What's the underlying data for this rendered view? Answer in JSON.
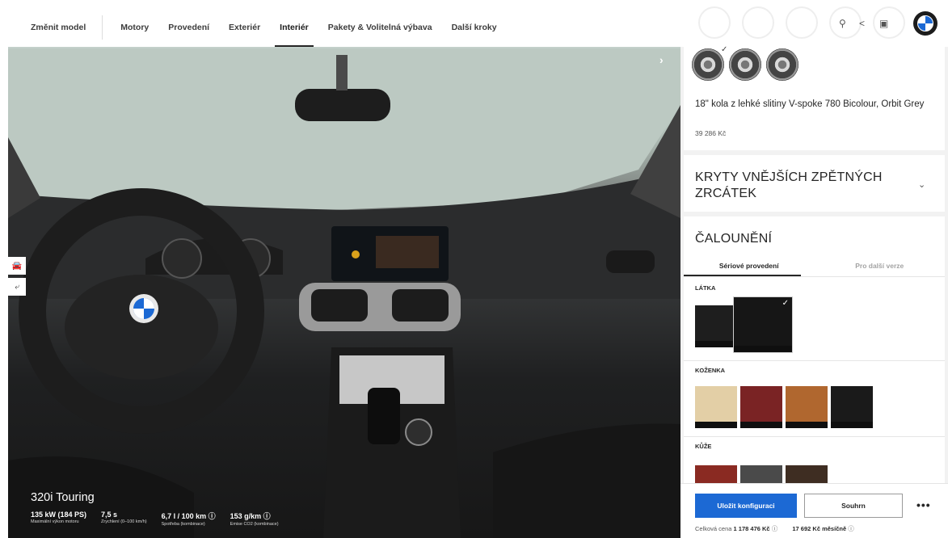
{
  "nav": {
    "items": [
      {
        "label": "Změnit model"
      },
      {
        "label": "Motory"
      },
      {
        "label": "Provedení"
      },
      {
        "label": "Exteriér"
      },
      {
        "label": "Interiér",
        "active": true
      },
      {
        "label": "Pakety & Volitelná výbava"
      },
      {
        "label": "Další kroky"
      }
    ]
  },
  "toolbar": {
    "icons": [
      "location-pin-icon",
      "share-icon",
      "save-disk-icon",
      "bmw-logo"
    ]
  },
  "wheels": {
    "name": "18\" kola z lehké slitiny V-spoke 780 Bicolour, Orbit Grey",
    "price": "39 286 Kč"
  },
  "mirror_section": {
    "title": "KRYTY VNĚJŠÍCH ZPĚTNÝCH ZRCÁTEK"
  },
  "upholstery": {
    "title": "ČALOUNĚNÍ",
    "tabs": [
      "Sériové provedení",
      "Pro další verze"
    ],
    "groups": [
      {
        "label": "LÁTKA"
      },
      {
        "label": "KOŽENKA"
      },
      {
        "label": "KŮŽE"
      }
    ]
  },
  "colors": {
    "accent": "#1c69d4",
    "swatch_koženka": [
      "#e3cfa6",
      "#7a2324",
      "#b0672f",
      "#1a1a1a"
    ],
    "swatch_kůže": [
      "#8a2a22",
      "#4a4a4a",
      "#3e2d22"
    ],
    "swatch_látka": [
      "#1e1e1e",
      "#161616"
    ]
  },
  "actions": {
    "save": "Uložit konfiguraci",
    "summary": "Souhrn",
    "more": "•••"
  },
  "totals": {
    "total_label": "Celková cena",
    "total_value": "1 178 476 Kč",
    "monthly_value": "17 692 Kč",
    "monthly_label": "měsíčně"
  },
  "vehicle": {
    "model": "320i Touring",
    "specs": [
      {
        "value": "135 kW (184 PS)",
        "label": "Maximální výkon motoru"
      },
      {
        "value": "7,5 s",
        "label": "Zrychlení (0–100 km/h)"
      },
      {
        "value": "6,7 l / 100 km ⓘ",
        "label": "Spotřeba (kombinace)"
      },
      {
        "value": "153 g/km ⓘ",
        "label": "Emise CO2 (kombinace)"
      }
    ]
  }
}
